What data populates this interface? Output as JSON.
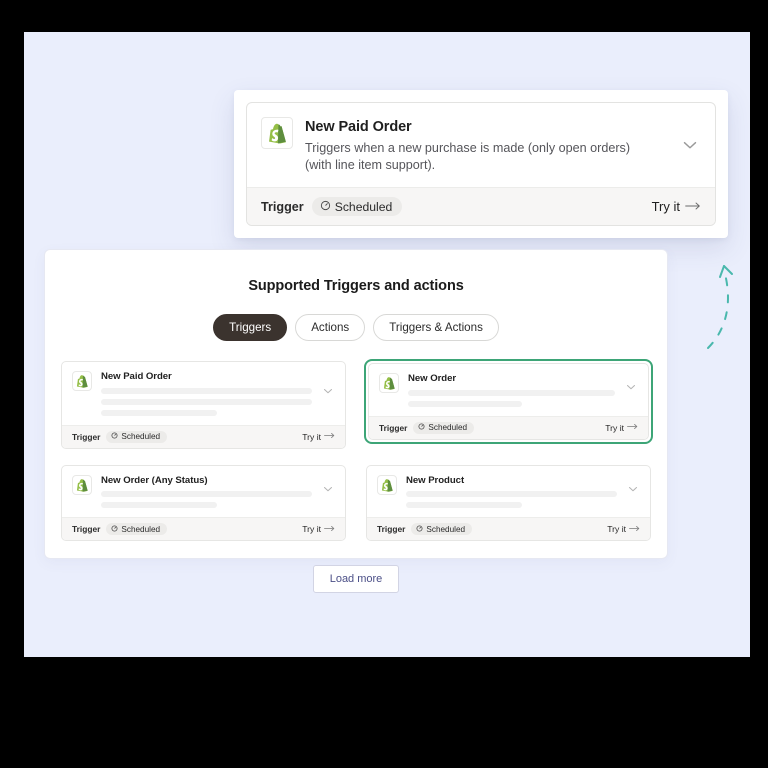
{
  "theme": {
    "page_background": "#eaeefc",
    "frame": "#000000",
    "panel_background": "#ffffff",
    "accent_green": "#3da577",
    "tab_active_background": "#3b332e",
    "link_color": "#4b4f87",
    "skeleton": "#f1f1f1"
  },
  "popover": {
    "card": {
      "icon": "shopify-bag-icon",
      "title": "New Paid Order",
      "description": "Triggers when a new purchase is made (only open orders) (with line item support).",
      "expand_icon": "chevron-down-icon",
      "footer": {
        "type_label": "Trigger",
        "schedule_icon": "clock-icon",
        "schedule_label": "Scheduled",
        "try_label": "Try it",
        "try_icon": "arrow-right-icon"
      }
    }
  },
  "panel": {
    "title": "Supported Triggers and actions",
    "tabs": [
      {
        "label": "Triggers",
        "active": true
      },
      {
        "label": "Actions",
        "active": false
      },
      {
        "label": "Triggers & Actions",
        "active": false
      }
    ],
    "cards": [
      {
        "icon": "shopify-bag-icon",
        "title": "New Paid Order",
        "selected": false,
        "skeleton_lines": 3,
        "expand_icon": "chevron-down-icon",
        "type_label": "Trigger",
        "schedule_icon": "clock-icon",
        "schedule_label": "Scheduled",
        "try_label": "Try it",
        "try_icon": "arrow-right-icon"
      },
      {
        "icon": "shopify-bag-icon",
        "title": "New Order",
        "selected": true,
        "skeleton_lines": 2,
        "expand_icon": "chevron-down-icon",
        "type_label": "Trigger",
        "schedule_icon": "clock-icon",
        "schedule_label": "Scheduled",
        "try_label": "Try it",
        "try_icon": "arrow-right-icon"
      },
      {
        "icon": "shopify-bag-icon",
        "title": "New Order (Any Status)",
        "selected": false,
        "skeleton_lines": 2,
        "expand_icon": "chevron-down-icon",
        "type_label": "Trigger",
        "schedule_icon": "clock-icon",
        "schedule_label": "Scheduled",
        "try_label": "Try it",
        "try_icon": "arrow-right-icon"
      },
      {
        "icon": "shopify-bag-icon",
        "title": "New Product",
        "selected": false,
        "skeleton_lines": 2,
        "expand_icon": "chevron-down-icon",
        "type_label": "Trigger",
        "schedule_icon": "clock-icon",
        "schedule_label": "Scheduled",
        "try_label": "Try it",
        "try_icon": "arrow-right-icon"
      }
    ],
    "load_more_label": "Load more"
  },
  "decoration": {
    "arrow_icon": "dashed-curved-arrow-icon",
    "arrow_color": "#4ab8ad"
  }
}
